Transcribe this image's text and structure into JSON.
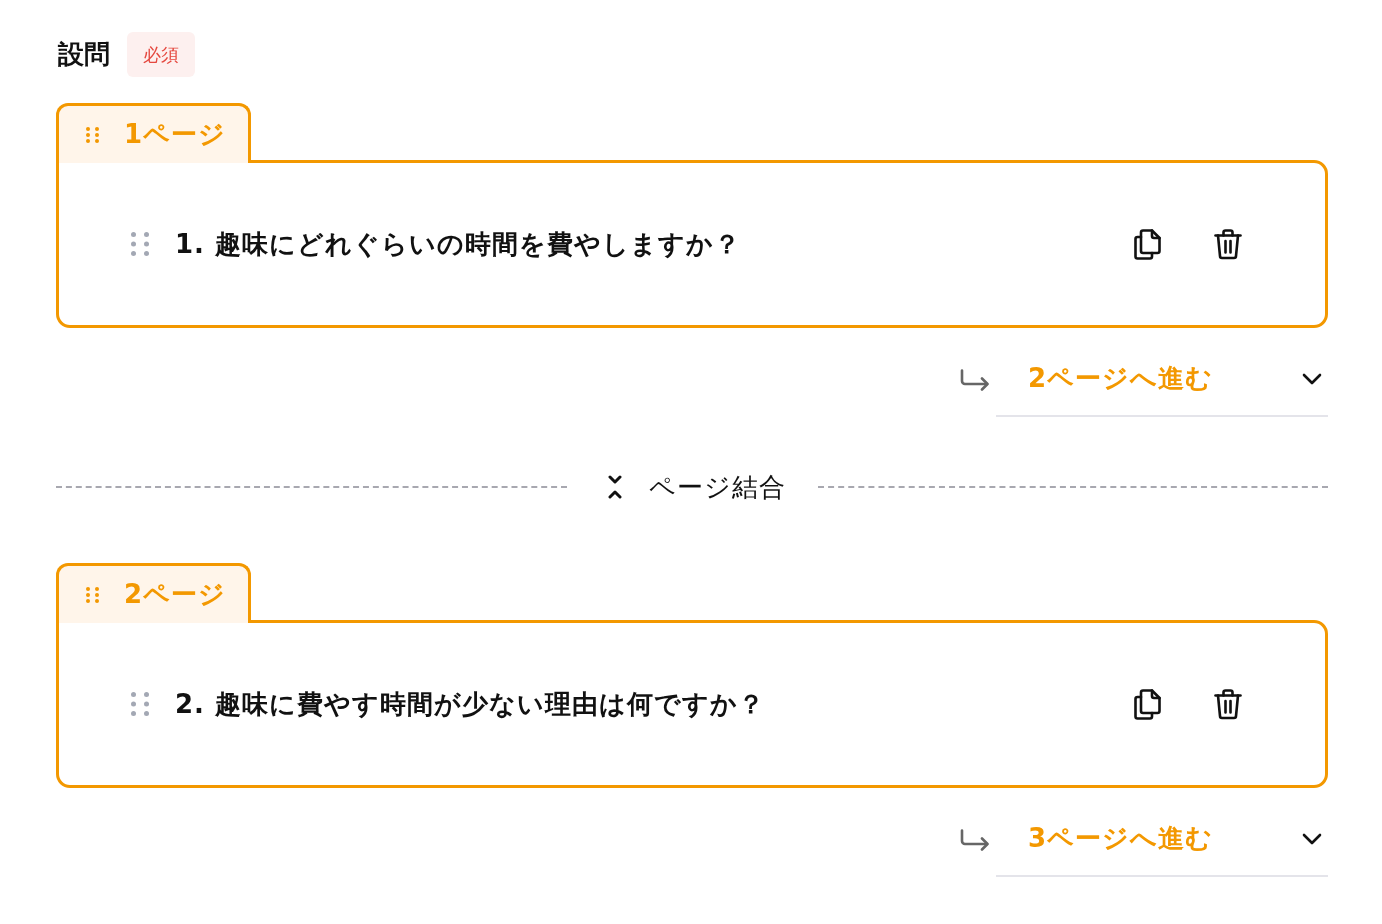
{
  "section_header": {
    "title": "設問",
    "badge": "必須"
  },
  "blocks": [
    {
      "kind": "page",
      "tab_label": "1ページ",
      "questions": [
        {
          "text": "1. 趣味にどれぐらいの時間を費やしますか？"
        }
      ],
      "next_page_select": {
        "value": "2ページへ進む"
      }
    },
    {
      "kind": "merge",
      "label": "ページ結合"
    },
    {
      "kind": "page",
      "tab_label": "2ページ",
      "questions": [
        {
          "text": "2. 趣味に費やす時間が少ない理由は何ですか？"
        }
      ],
      "next_page_select": {
        "value": "3ページへ進む"
      }
    }
  ]
}
